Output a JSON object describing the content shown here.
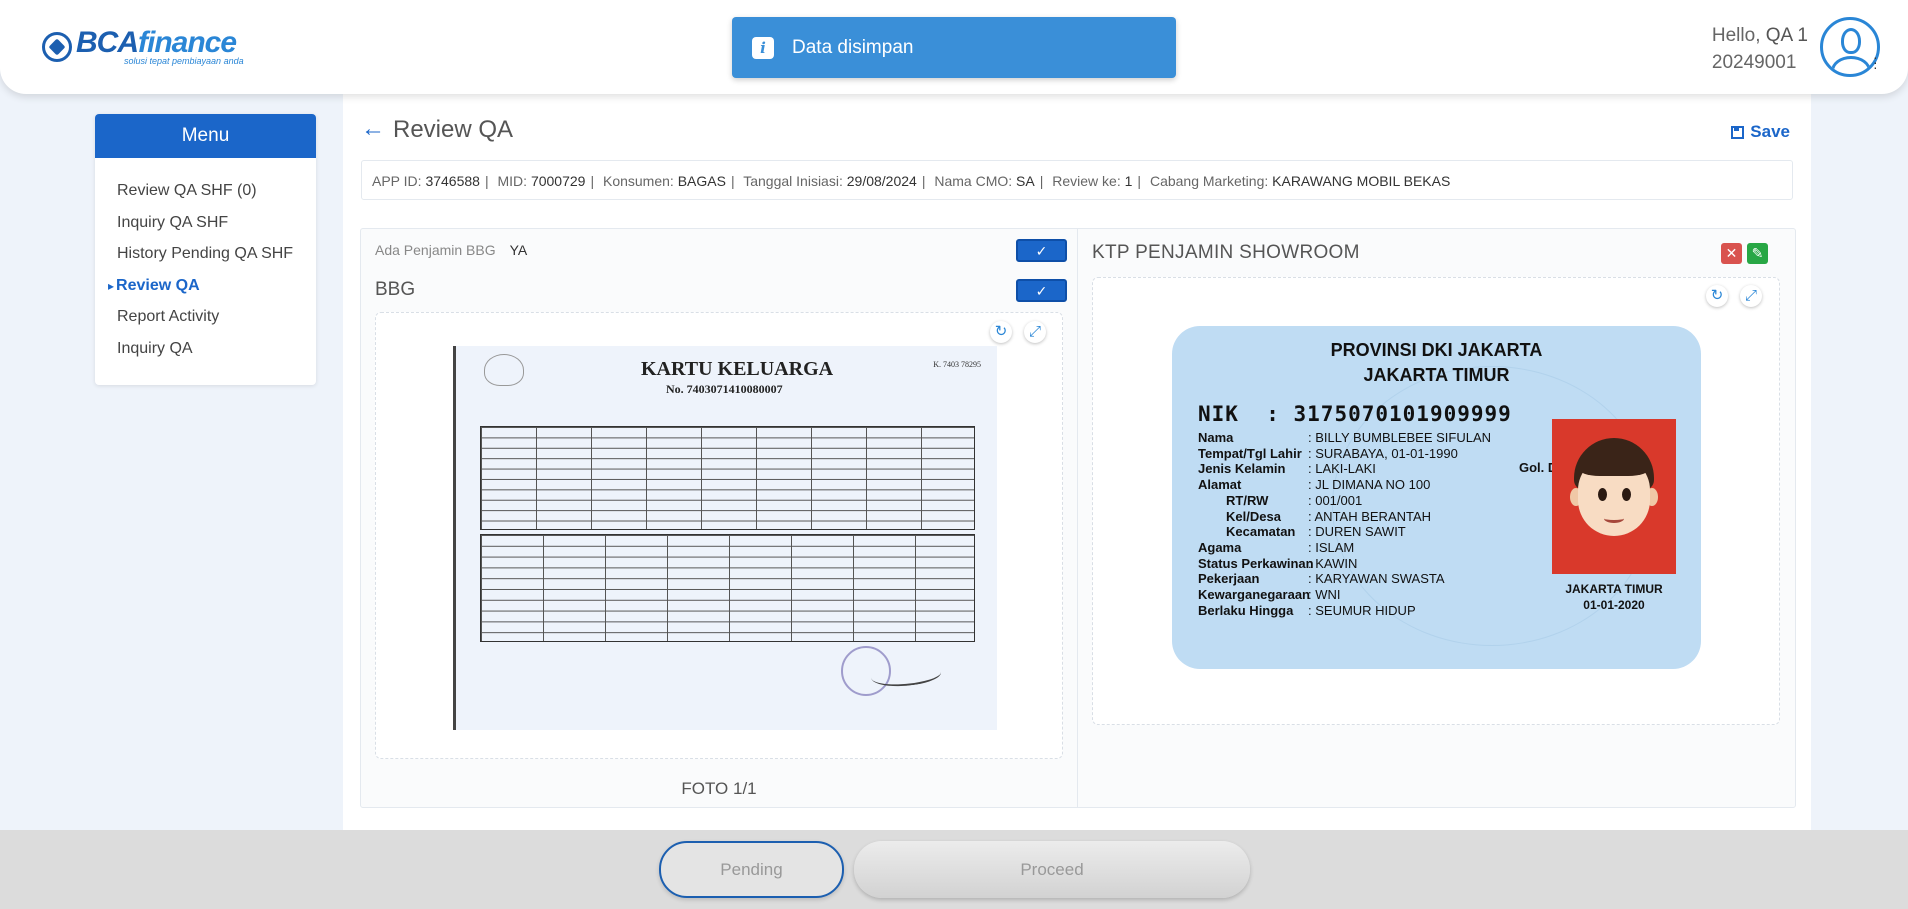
{
  "brand": {
    "name_part1": "BCA",
    "name_part2": "finance",
    "tagline": "solusi tepat pembiayaan anda",
    "color": "#1c5fb0"
  },
  "toast": {
    "icon": "info-icon",
    "message": "Data disimpan"
  },
  "user": {
    "greeting": "Hello,",
    "name": "QA 1",
    "id": "20249001"
  },
  "menu": {
    "title": "Menu",
    "items": [
      {
        "label": "Review QA SHF (0)",
        "active": false
      },
      {
        "label": "Inquiry QA SHF",
        "active": false
      },
      {
        "label": "History Pending QA SHF",
        "active": false
      },
      {
        "label": "Review QA",
        "active": true
      },
      {
        "label": "Report Activity",
        "active": false
      },
      {
        "label": "Inquiry QA",
        "active": false
      }
    ]
  },
  "page": {
    "title": "Review QA",
    "save_label": "Save"
  },
  "info": [
    {
      "key": "APP ID:",
      "value": "3746588"
    },
    {
      "key": "MID:",
      "value": "7000729"
    },
    {
      "key": "Konsumen:",
      "value": "BAGAS"
    },
    {
      "key": "Tanggal Inisiasi:",
      "value": "29/08/2024"
    },
    {
      "key": "Nama CMO:",
      "value": "SA"
    },
    {
      "key": "Review ke:",
      "value": "1"
    },
    {
      "key": "Cabang Marketing:",
      "value": "KARAWANG MOBIL BEKAS"
    }
  ],
  "left_panel": {
    "ada_label": "Ada Penjamin BBG",
    "ada_value": "YA",
    "section": "BBG",
    "foto_count": "FOTO 1/1",
    "document": {
      "title": "KARTU KELUARGA",
      "number": "No. 7403071410080007",
      "code": "K. 7403 78295"
    }
  },
  "right_panel": {
    "title": "KTP PENJAMIN SHOWROOM",
    "ktp": {
      "province": "PROVINSI DKI JAKARTA",
      "city": "JAKARTA TIMUR",
      "nik_label": "NIK",
      "nik": ": 3175070101909999",
      "rows": [
        {
          "k": "Nama",
          "v": ": BILLY BUMBLEBEE SIFULAN",
          "sub": false
        },
        {
          "k": "Tempat/Tgl Lahir",
          "v": ": SURABAYA, 01-01-1990",
          "sub": false
        },
        {
          "k": "Jenis Kelamin",
          "v": ": LAKI-LAKI",
          "sub": false
        },
        {
          "k": "Alamat",
          "v": ": JL DIMANA NO 100",
          "sub": false
        },
        {
          "k": "RT/RW",
          "v": ": 001/001",
          "sub": true
        },
        {
          "k": "Kel/Desa",
          "v": ": ANTAH BERANTAH",
          "sub": true
        },
        {
          "k": "Kecamatan",
          "v": ": DUREN SAWIT",
          "sub": true
        },
        {
          "k": "Agama",
          "v": ": ISLAM",
          "sub": false
        },
        {
          "k": "Status Perkawinan",
          "v": ": KAWIN",
          "sub": false
        },
        {
          "k": "Pekerjaan",
          "v": ": KARYAWAN SWASTA",
          "sub": false
        },
        {
          "k": "Kewarganegaraan",
          "v": ": WNI",
          "sub": false
        },
        {
          "k": "Berlaku Hingga",
          "v": ": SEUMUR HIDUP",
          "sub": false
        }
      ],
      "gol_darah": "Gol. Darah : AB",
      "issue_place": "JAKARTA TIMUR",
      "issue_date": "01-01-2020"
    }
  },
  "actions": {
    "pending": "Pending",
    "proceed": "Proceed"
  }
}
